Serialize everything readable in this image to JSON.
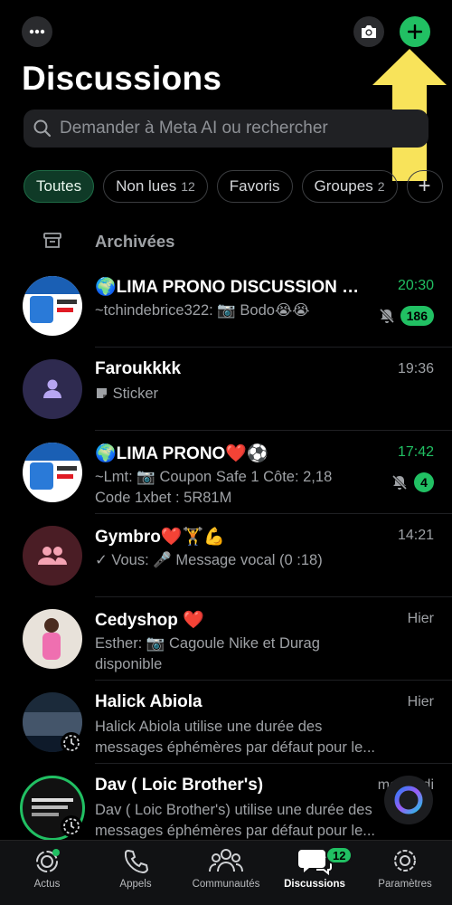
{
  "header": {
    "title": "Discussions",
    "menu_icon": "more-dots-icon",
    "camera_icon": "camera-icon",
    "new_chat_icon": "plus-icon"
  },
  "search": {
    "placeholder": "Demander à Meta AI ou rechercher"
  },
  "filters": [
    {
      "label": "Toutes",
      "count": ""
    },
    {
      "label": "Non lues",
      "count": "12"
    },
    {
      "label": "Favoris",
      "count": ""
    },
    {
      "label": "Groupes",
      "count": "2"
    }
  ],
  "archived": {
    "label": "Archivées"
  },
  "chats": [
    {
      "name": "🌍LIMA PRONO DISCUSSION ❤️...",
      "time": "20:30",
      "line1": "~tchindebrice322: 📷 Bodo😭😭",
      "line2": "",
      "unread": "186"
    },
    {
      "name": "Faroukkkk",
      "time": "19:36",
      "line1": "Sticker",
      "line2": "",
      "unread": ""
    },
    {
      "name": "🌍LIMA PRONO❤️⚽",
      "time": "17:42",
      "line1": "~Lmt: 📷 Coupon Safe 1 Côte: 2,18",
      "line2": "Code 1xbet : 5R81M",
      "unread": "4"
    },
    {
      "name": "Gymbro❤️🏋️💪",
      "time": "14:21",
      "line1": "✓ Vous: 🎤 Message vocal (0 :18)",
      "line2": "",
      "unread": ""
    },
    {
      "name": "Cedyshop ❤️",
      "time": "Hier",
      "line1": "Esther: 📷 Cagoule Nike et Durag",
      "line2": "disponible",
      "unread": ""
    },
    {
      "name": "Halick Abiola",
      "time": "Hier",
      "line1": "Halick Abiola utilise une durée des",
      "line2": "messages éphémères par défaut pour le...",
      "unread": ""
    },
    {
      "name": "Dav ( Loic Brother's)",
      "time": "mercredi",
      "line1": "Dav ( Loic Brother's) utilise une durée des",
      "line2": "messages éphémères par défaut pour le...",
      "unread": ""
    }
  ],
  "nav": [
    {
      "label": "Actus",
      "icon": "updates-icon"
    },
    {
      "label": "Appels",
      "icon": "phone-icon"
    },
    {
      "label": "Communautés",
      "icon": "communities-icon"
    },
    {
      "label": "Discussions",
      "icon": "chats-icon",
      "badge": "12"
    },
    {
      "label": "Paramètres",
      "icon": "settings-icon"
    }
  ],
  "colors": {
    "accent": "#21c063",
    "background": "#000000",
    "arrow": "#f8e35a"
  }
}
